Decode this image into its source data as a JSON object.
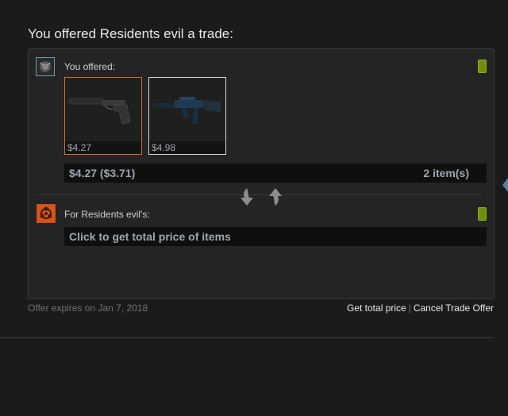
{
  "header": {
    "title": "You offered Residents evil a trade:"
  },
  "you": {
    "label": "You offered:",
    "items": [
      {
        "price": "$4.27"
      },
      {
        "price": "$4.98"
      }
    ],
    "summary_price": "$4.27 ($3.71)",
    "summary_count": "2 item(s)"
  },
  "them": {
    "label": "For Residents evil's:",
    "summary_prompt": "Click to get total price of items"
  },
  "footer": {
    "expires": "Offer expires on Jan 7, 2018",
    "get_total_price": "Get total price",
    "separator": "|",
    "cancel": "Cancel Trade Offer"
  },
  "colors": {
    "status_active": "#6f8f10",
    "item_border_covert": "#cf6a32",
    "item_border_default": "#d8d8d8"
  }
}
